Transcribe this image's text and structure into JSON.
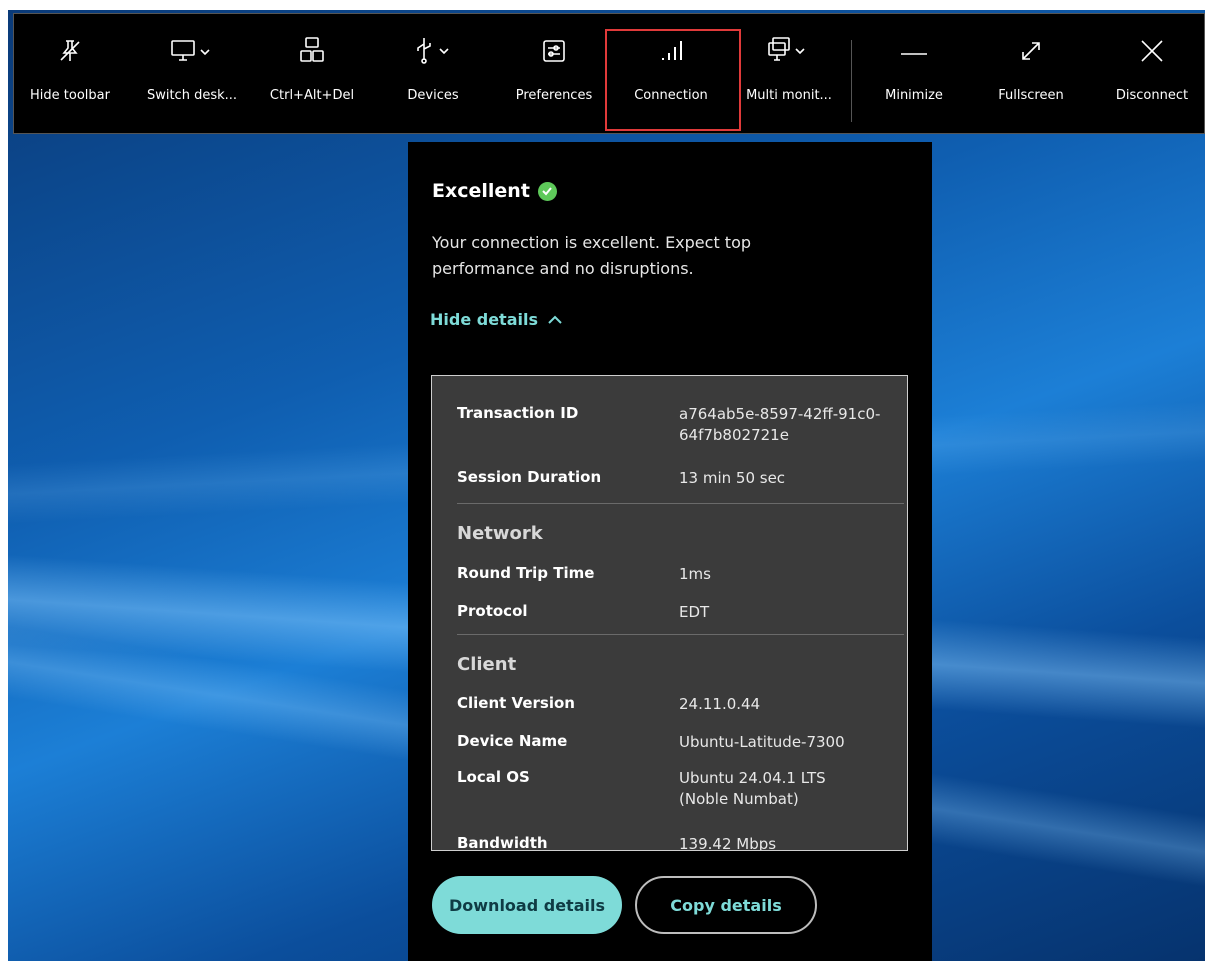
{
  "toolbar": {
    "items": [
      {
        "label": "Hide toolbar",
        "icon": "pin-off-icon"
      },
      {
        "label": "Switch desk...",
        "icon": "monitor-icon"
      },
      {
        "label": "Ctrl+Alt+Del",
        "icon": "keyboard-keys-icon"
      },
      {
        "label": "Devices",
        "icon": "usb-icon"
      },
      {
        "label": "Preferences",
        "icon": "sliders-icon"
      },
      {
        "label": "Connection",
        "icon": "signal-bars-icon"
      },
      {
        "label": "Multi monit...",
        "icon": "multi-monitor-icon"
      },
      {
        "label": "Minimize",
        "icon": "minimize-icon"
      },
      {
        "label": "Fullscreen",
        "icon": "expand-icon"
      },
      {
        "label": "Disconnect",
        "icon": "close-icon"
      }
    ],
    "highlight_color": "#e03a3a"
  },
  "panel": {
    "status": "Excellent",
    "status_color": "#5ec95a",
    "description": "Your connection is excellent. Expect top performance and no disruptions.",
    "toggle_label": "Hide details",
    "details": {
      "transaction_id_label": "Transaction ID",
      "transaction_id_value": "a764ab5e-8597-42ff-91c0-64f7b802721e",
      "session_duration_label": "Session Duration",
      "session_duration_value": "13 min 50 sec",
      "network_heading": "Network",
      "rtt_label": "Round Trip Time",
      "rtt_value": "1ms",
      "protocol_label": "Protocol",
      "protocol_value": "EDT",
      "client_heading": "Client",
      "client_version_label": "Client Version",
      "client_version_value": "24.11.0.44",
      "device_name_label": "Device Name",
      "device_name_value": "Ubuntu-Latitude-7300",
      "local_os_label": "Local OS",
      "local_os_value": "Ubuntu 24.04.1 LTS (Noble Numbat)",
      "bandwidth_label": "Bandwidth",
      "bandwidth_value": "139.42 Mbps"
    },
    "download_label": "Download details",
    "copy_label": "Copy details",
    "accent_color": "#7edbd8"
  }
}
